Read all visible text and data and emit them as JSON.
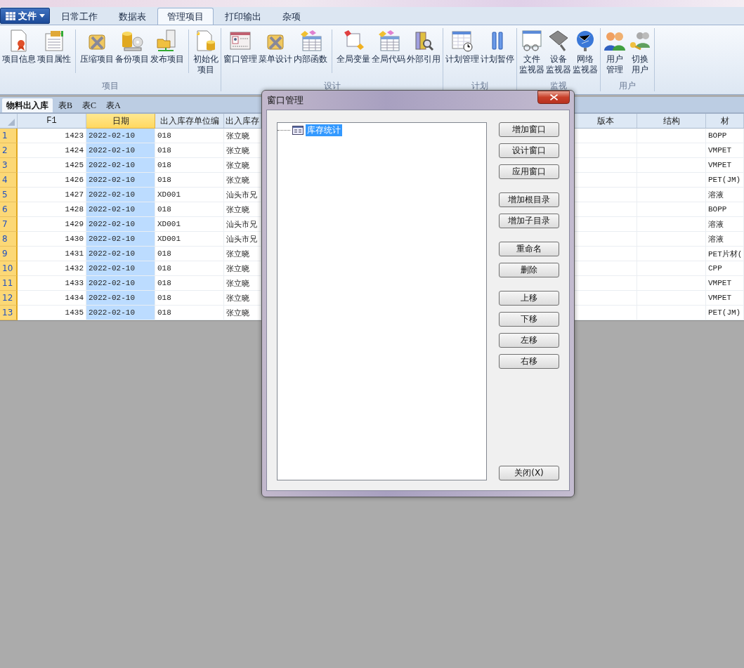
{
  "file_menu": {
    "label": "文件"
  },
  "ribbon_tabs": [
    {
      "label": "日常工作",
      "selected": false
    },
    {
      "label": "数据表",
      "selected": false
    },
    {
      "label": "管理项目",
      "selected": true
    },
    {
      "label": "打印输出",
      "selected": false
    },
    {
      "label": "杂项",
      "selected": false
    }
  ],
  "ribbon_groups": [
    {
      "label": "项目",
      "sections": [
        [
          {
            "lines": [
              "项目信息"
            ]
          },
          {
            "lines": [
              "项目属性"
            ]
          }
        ],
        [
          {
            "lines": [
              "压缩项目"
            ]
          },
          {
            "lines": [
              "备份项目"
            ]
          },
          {
            "lines": [
              "发布项目"
            ]
          }
        ],
        [
          {
            "lines": [
              "初始化",
              "项目"
            ]
          }
        ]
      ]
    },
    {
      "label": "设计",
      "sections": [
        [
          {
            "lines": [
              "窗口管理"
            ]
          },
          {
            "lines": [
              "菜单设计"
            ]
          },
          {
            "lines": [
              "内部函数"
            ]
          }
        ],
        [
          {
            "lines": [
              "全局变量"
            ]
          },
          {
            "lines": [
              "全局代码"
            ]
          },
          {
            "lines": [
              "外部引用"
            ]
          }
        ]
      ]
    },
    {
      "label": "计划",
      "sections": [
        [
          {
            "lines": [
              "计划管理"
            ]
          },
          {
            "lines": [
              "计划暂停"
            ]
          }
        ]
      ]
    },
    {
      "label": "监视",
      "sections": [
        [
          {
            "lines": [
              "文件",
              "监视器"
            ]
          },
          {
            "lines": [
              "设备",
              "监视器"
            ]
          },
          {
            "lines": [
              "网络",
              "监视器"
            ]
          }
        ]
      ]
    },
    {
      "label": "用户",
      "sections": [
        [
          {
            "lines": [
              "用户",
              "管理"
            ]
          },
          {
            "lines": [
              "切换",
              "用户"
            ]
          }
        ]
      ]
    }
  ],
  "sheet_tabs": [
    {
      "label": "物料出入库",
      "selected": true
    },
    {
      "label": "表B",
      "selected": false
    },
    {
      "label": "表C",
      "selected": false
    },
    {
      "label": "表A",
      "selected": false
    }
  ],
  "grid": {
    "columns": [
      {
        "label": "F1",
        "kind": "number",
        "selected": false
      },
      {
        "label": "日期",
        "kind": "text",
        "selected": true
      },
      {
        "label": "出入库存单位编",
        "kind": "text",
        "selected": false
      },
      {
        "label": "出入库存",
        "kind": "text",
        "selected": false
      },
      {
        "label": "版本",
        "kind": "text",
        "selected": false
      },
      {
        "label": "结构",
        "kind": "text",
        "selected": false
      },
      {
        "label": "材",
        "kind": "text",
        "selected": false
      }
    ],
    "rows": [
      {
        "number": "1",
        "cells": [
          "1423",
          "2022-02-10",
          "018",
          "张立晓",
          null,
          null,
          "BOPP"
        ]
      },
      {
        "number": "2",
        "cells": [
          "1424",
          "2022-02-10",
          "018",
          "张立晓",
          null,
          null,
          "VMPET"
        ]
      },
      {
        "number": "3",
        "cells": [
          "1425",
          "2022-02-10",
          "018",
          "张立晓",
          null,
          null,
          "VMPET"
        ]
      },
      {
        "number": "4",
        "cells": [
          "1426",
          "2022-02-10",
          "018",
          "张立晓",
          null,
          null,
          "PET(JM)"
        ]
      },
      {
        "number": "5",
        "cells": [
          "1427",
          "2022-02-10",
          "XD001",
          "汕头市兄",
          null,
          null,
          "溶液"
        ]
      },
      {
        "number": "6",
        "cells": [
          "1428",
          "2022-02-10",
          "018",
          "张立晓",
          null,
          null,
          "BOPP"
        ]
      },
      {
        "number": "7",
        "cells": [
          "1429",
          "2022-02-10",
          "XD001",
          "汕头市兄",
          null,
          null,
          "溶液"
        ]
      },
      {
        "number": "8",
        "cells": [
          "1430",
          "2022-02-10",
          "XD001",
          "汕头市兄",
          null,
          null,
          "溶液"
        ]
      },
      {
        "number": "9",
        "cells": [
          "1431",
          "2022-02-10",
          "018",
          "张立晓",
          null,
          null,
          "PET片材("
        ]
      },
      {
        "number": "10",
        "cells": [
          "1432",
          "2022-02-10",
          "018",
          "张立晓",
          null,
          null,
          "CPP"
        ]
      },
      {
        "number": "11",
        "cells": [
          "1433",
          "2022-02-10",
          "018",
          "张立晓",
          null,
          null,
          "VMPET"
        ]
      },
      {
        "number": "12",
        "cells": [
          "1434",
          "2022-02-10",
          "018",
          "张立晓",
          null,
          null,
          "VMPET"
        ]
      },
      {
        "number": "13",
        "cells": [
          "1435",
          "2022-02-10",
          "018",
          "张立晓",
          null,
          null,
          "PET(JM)"
        ]
      }
    ]
  },
  "dialog": {
    "title": "窗口管理",
    "tree": [
      {
        "label": "库存统计",
        "selected": true
      }
    ],
    "button_groups": [
      [
        "增加窗口",
        "设计窗口",
        "应用窗口"
      ],
      [
        "增加根目录",
        "增加子目录"
      ],
      [
        "重命名",
        "删除"
      ],
      [
        "上移",
        "下移",
        "左移",
        "右移"
      ]
    ],
    "close_button": "关闭(X)"
  }
}
